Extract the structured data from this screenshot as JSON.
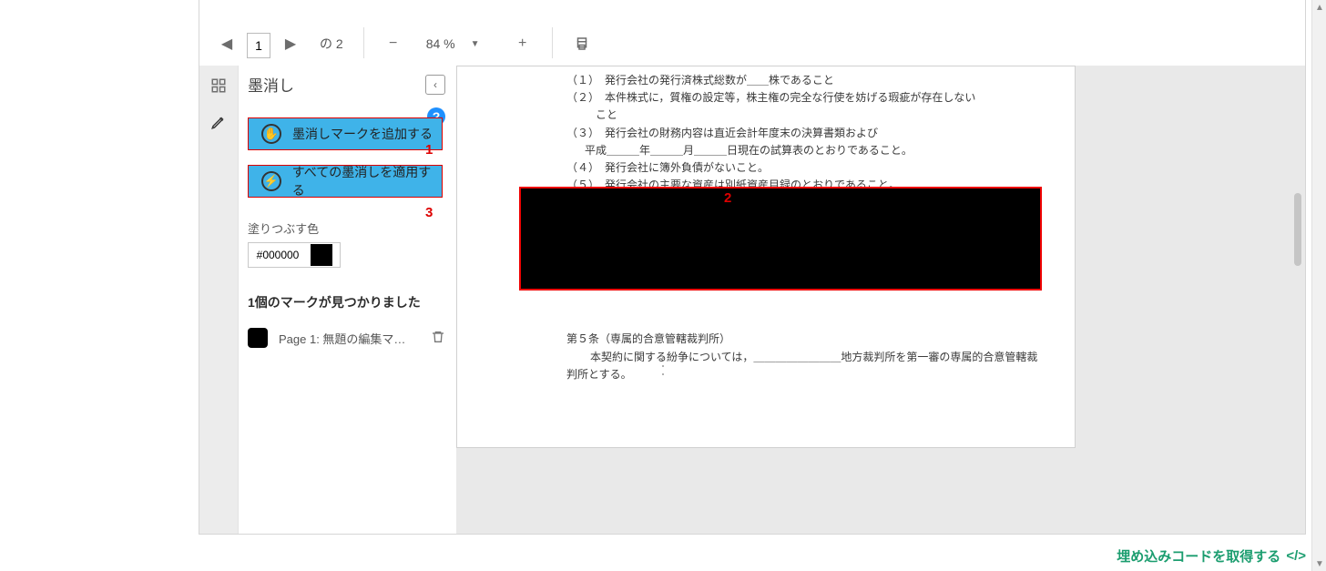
{
  "toolbar": {
    "page_num": "1",
    "page_of": "の 2",
    "zoom": "84 %"
  },
  "panel": {
    "title": "墨消し",
    "add_mark": "墨消しマークを追加する",
    "apply_all": "すべての墨消しを適用する",
    "fill_color_label": "塗りつぶす色",
    "fill_color_value": "#000000",
    "marks_found": "1個のマークが見つかりました",
    "mark_item_text": "Page 1: 無題の編集マ…"
  },
  "doc": {
    "l1": "（１）　発行会社の発行済株式総数が＿＿株であること",
    "l2": "（２）　本件株式に，質権の設定等，株主権の完全な行使を妨げる瑕疵が存在しない",
    "l2b": "こと",
    "l3": "（３）　発行会社の財務内容は直近会計年度末の決算書類および",
    "l3b": "平成＿＿＿年＿＿＿月＿＿＿日現在の試算表のとおりであること。",
    "l4": "（４）　発行会社に簿外負債がないこと。",
    "l5": "（５）　発行会社の主要な資産は別紙資産目録のとおりであること。",
    "art5_title": "第５条（専属的合意管轄裁判所）",
    "art5_body1": "本契約に関する紛争については，＿＿＿＿＿＿＿＿地方裁判所を第一審の専属的合意管轄裁",
    "art5_body2": "判所とする。"
  },
  "annotations": {
    "a1": "1",
    "a2": "2",
    "a3": "3"
  },
  "footer": {
    "embed": "埋め込みコードを取得する"
  }
}
